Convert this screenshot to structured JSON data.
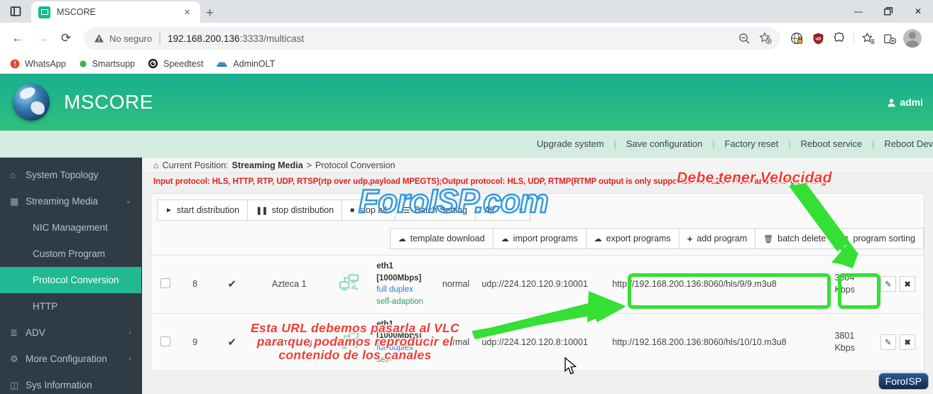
{
  "browser": {
    "tab": {
      "title": "MSCORE",
      "favicon": "monitor-icon",
      "close": "×"
    },
    "new_tab_label": "+",
    "window_controls": {
      "minimize": "—",
      "maximize": "❐",
      "close": "✕"
    },
    "nav": {
      "back": "←",
      "forward": "→",
      "reload": "⟳"
    },
    "omnibox": {
      "security_label": "No seguro",
      "url_host": "192.168.200.136",
      "url_rest": ":3333/multicast",
      "zoom_icon": "zoom-out-icon",
      "bookmark_icon": "add-bookmark-icon"
    },
    "extensions": [
      "globe-lock-icon",
      "ublock-shield-icon",
      "puzzle-extension-icon",
      "favorites-icon",
      "tab-collections-icon"
    ],
    "bookmarks": [
      {
        "label": "WhatsApp",
        "icon": "whatsapp-icon",
        "color": "#ea4335"
      },
      {
        "label": "Smartsupp",
        "icon": "smartsupp-icon",
        "color": "#38b44a"
      },
      {
        "label": "Speedtest",
        "icon": "speedtest-icon",
        "color": "#1a1a1a"
      },
      {
        "label": "AdminOLT",
        "icon": "adminolt-icon",
        "color": "#3d8fd1"
      }
    ]
  },
  "app": {
    "title": "MSCORE",
    "logo": "globe-logo",
    "user": {
      "label": "admi",
      "icon": "user-icon"
    },
    "system_actions": [
      "Upgrade system",
      "Save configuration",
      "Factory reset",
      "Reboot service",
      "Reboot Dev"
    ],
    "sidebar": [
      {
        "label": "System Topology",
        "icon": "home-icon",
        "level": "top",
        "active": false,
        "caret": ""
      },
      {
        "label": "Streaming Media",
        "icon": "film-icon",
        "level": "top",
        "active": false,
        "caret": "⌄"
      },
      {
        "label": "NIC Management",
        "icon": "",
        "level": "sub",
        "active": false,
        "caret": ""
      },
      {
        "label": "Custom Program",
        "icon": "",
        "level": "sub",
        "active": false,
        "caret": ""
      },
      {
        "label": "Protocol Conversion",
        "icon": "",
        "level": "sub",
        "active": true,
        "caret": ""
      },
      {
        "label": "HTTP",
        "icon": "",
        "level": "sub",
        "active": false,
        "caret": ""
      },
      {
        "label": "ADV",
        "icon": "list-icon",
        "level": "top",
        "active": false,
        "caret": "‹"
      },
      {
        "label": "More Configuration",
        "icon": "gears-icon",
        "level": "top",
        "active": false,
        "caret": "‹"
      },
      {
        "label": "Sys Information",
        "icon": "server-icon",
        "level": "top",
        "active": false,
        "caret": ""
      }
    ],
    "breadcrumb": {
      "icon": "home-icon",
      "prefix": "Current Position:",
      "parent": "Streaming Media",
      "separator": ">",
      "current": "Protocol Conversion"
    },
    "warning": "Input protocol: HLS, HTTP, RTP, UDP,  RTSP(rtp over udp,payload MPEGTS);Output protocol: HLS, UDP, RTMP(RTMP output is only supported for H.264 video and AAC encoding",
    "toolbar_primary": [
      {
        "label": "start distribution",
        "icon": "play-icon"
      },
      {
        "label": "stop distribution",
        "icon": "pause-icon"
      },
      {
        "label": "stop all",
        "icon": "stop-icon"
      },
      {
        "label": "Batch Setting",
        "icon": "hamburger-icon"
      }
    ],
    "filter_select": {
      "value": "All",
      "caret": "⌄"
    },
    "toolbar_secondary": [
      {
        "label": "template download",
        "icon": "cloud-download-icon"
      },
      {
        "label": "import programs",
        "icon": "cloud-upload-icon"
      },
      {
        "label": "export programs",
        "icon": "cloud-export-icon"
      },
      {
        "label": "add program",
        "icon": "plus-icon"
      },
      {
        "label": "batch delete",
        "icon": "trash-icon"
      },
      {
        "label": "program sorting",
        "icon": "sort-list-icon"
      }
    ],
    "rows": [
      {
        "id": "8",
        "status_icon": "check-icon",
        "name": "Azteca 1",
        "net_icon": "network-devices-icon",
        "nic": "eth1",
        "speed": "[1000Mbps]",
        "duplex": "full duplex",
        "adaption": "self-adaption",
        "state": "normal",
        "input_url": "udp://224.120.120.9:10001",
        "output_url": "http://192.168.200.136:8060/hls/9/9.m3u8",
        "bandwidth_value": "3304",
        "bandwidth_unit": "Kbps",
        "edit_icon": "pencil-icon",
        "delete_icon": "close-icon"
      },
      {
        "id": "9",
        "status_icon": "check-icon",
        "name": "Boomerang",
        "net_icon": "network-devices-icon",
        "nic": "eth1",
        "speed": "[1000Mbps]",
        "duplex": "full duplex",
        "adaption": "self-",
        "state": "normal",
        "input_url": "udp://224.120.120.8:10001",
        "output_url": "http://192.168.200.136:8060/hls/10/10.m3u8",
        "bandwidth_value": "3801",
        "bandwidth_unit": "Kbps",
        "edit_icon": "pencil-icon",
        "delete_icon": "close-icon"
      }
    ]
  },
  "annotations": {
    "top_right_note": "Debe tener Velocidad",
    "url_note_lines": [
      "Esta URL debemos pasarla al VLC",
      "para que podamos reproducir el",
      "contenido de los canales"
    ],
    "watermark": "ForoISP.com",
    "badge": "ForoISP",
    "highlight_color": "#35e035",
    "note_color": "#f23c34"
  }
}
